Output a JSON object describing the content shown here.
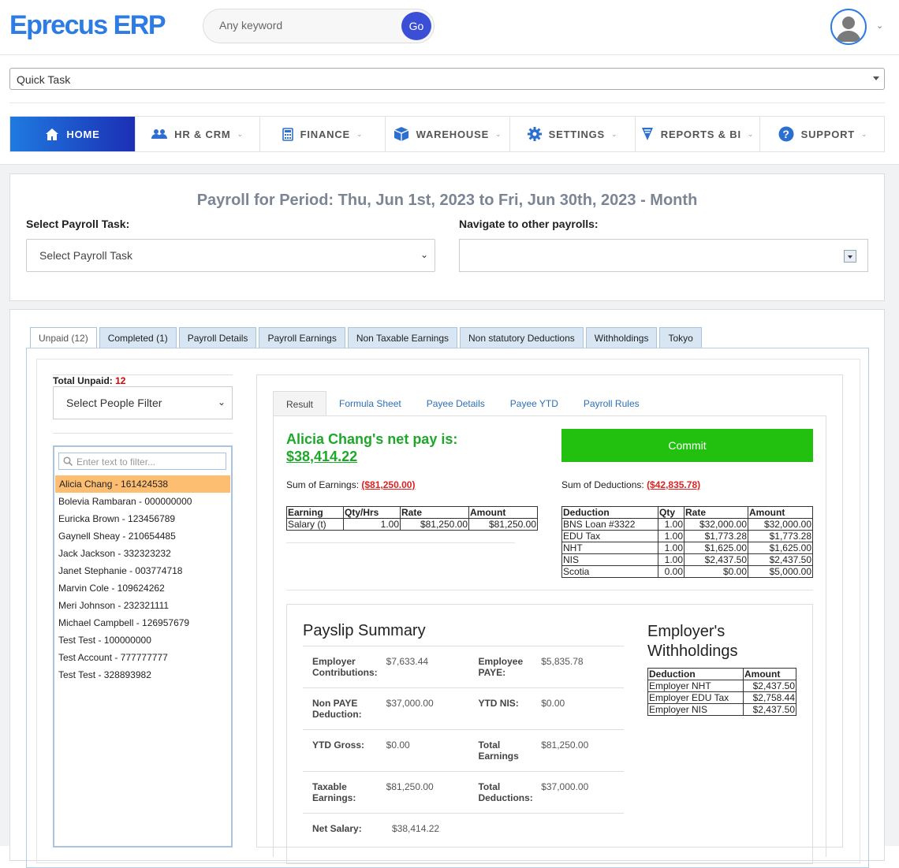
{
  "app": {
    "logo": "Eprecus ERP"
  },
  "search": {
    "placeholder": "Any keyword",
    "go_label": "Go"
  },
  "quick_task": {
    "value": "Quick Task"
  },
  "nav": {
    "items": [
      {
        "label": "HOME",
        "icon": "home-icon",
        "active": true
      },
      {
        "label": "HR & CRM",
        "icon": "users-icon"
      },
      {
        "label": "FINANCE",
        "icon": "calculator-icon"
      },
      {
        "label": "WAREHOUSE",
        "icon": "box-icon"
      },
      {
        "label": "SETTINGS",
        "icon": "gear-icon"
      },
      {
        "label": "REPORTS & BI",
        "icon": "chart-icon"
      },
      {
        "label": "SUPPORT",
        "icon": "question-icon"
      }
    ]
  },
  "payroll": {
    "title": "Payroll for Period: Thu, Jun 1st, 2023 to Fri, Jun 30th, 2023 - Month",
    "task_label": "Select Payroll Task:",
    "task_value": "Select Payroll Task",
    "nav_label": "Navigate to other payrolls:"
  },
  "tabs": [
    "Unpaid (12)",
    "Completed (1)",
    "Payroll Details",
    "Payroll Earnings",
    "Non Taxable Earnings",
    "Non statutory Deductions",
    "Withholdings",
    "Tokyo"
  ],
  "left": {
    "total_label": "Total Unpaid:",
    "total_value": "12",
    "filter_select": "Select People Filter",
    "filter_placeholder": "Enter text to filter...",
    "people": [
      "Alicia Chang - 161424538",
      "Bolevia Rambaran - 000000000",
      "Euricka Brown - 123456789",
      "Gaynell Sheay - 210654485",
      "Jack Jackson - 332323232",
      "Janet Stephanie  - 003774718",
      "Marvin Cole - 109624262",
      "Meri Johnson - 232321111",
      "Michael Campbell - 126957679",
      "Test Test - 100000000",
      "Test Account - 777777777",
      "Test Test - 328893982"
    ]
  },
  "result_tabs": [
    "Result",
    "Formula Sheet",
    "Payee Details",
    "Payee YTD",
    "Payroll Rules"
  ],
  "result": {
    "netpay_label": "Alicia Chang's net pay is:",
    "netpay_amount": "$38,414.22",
    "commit_label": "Commit",
    "sum_earn_label": "Sum of Earnings:",
    "sum_earn_value": "($81,250.00)",
    "sum_ded_label": "Sum of Deductions:",
    "sum_ded_value": "($42,835.78)",
    "earn_headers": [
      "Earning",
      "Qty/Hrs",
      "Rate",
      "Amount"
    ],
    "earn_rows": [
      [
        "Salary (t)",
        "1.00",
        "$81,250.00",
        "$81,250.00"
      ]
    ],
    "ded_headers": [
      "Deduction",
      "Qty",
      "Rate",
      "Amount"
    ],
    "ded_rows": [
      [
        "BNS Loan #3322",
        "1.00",
        "$32,000.00",
        "$32,000.00"
      ],
      [
        "EDU Tax",
        "1.00",
        "$1,773.28",
        "$1,773.28"
      ],
      [
        "NHT",
        "1.00",
        "$1,625.00",
        "$1,625.00"
      ],
      [
        "NIS",
        "1.00",
        "$2,437.50",
        "$2,437.50"
      ],
      [
        "Scotia",
        "0.00",
        "$0.00",
        "$5,000.00"
      ]
    ]
  },
  "payslip": {
    "title": "Payslip Summary",
    "rows": [
      [
        [
          "Employer Contributions:",
          "$7,633.44"
        ],
        [
          "Employee PAYE:",
          "$5,835.78"
        ]
      ],
      [
        [
          "Non PAYE Deduction:",
          "$37,000.00"
        ],
        [
          "YTD NIS:",
          "$0.00"
        ]
      ],
      [
        [
          "YTD Gross:",
          "$0.00"
        ],
        [
          "Total Earnings",
          "$81,250.00"
        ]
      ],
      [
        [
          "Taxable Earnings:",
          "$81,250.00"
        ],
        [
          "Total Deductions:",
          "$37,000.00"
        ]
      ],
      [
        [
          "Net Salary:",
          "$38,414.22"
        ]
      ]
    ],
    "withholdings_title": "Employer's Withholdings",
    "wh_headers": [
      "Deduction",
      "Amount"
    ],
    "wh_rows": [
      [
        "Employer NHT",
        "$2,437.50"
      ],
      [
        "Employer EDU Tax",
        "$2,758.44"
      ],
      [
        "Employer NIS",
        "$2,437.50"
      ]
    ]
  }
}
